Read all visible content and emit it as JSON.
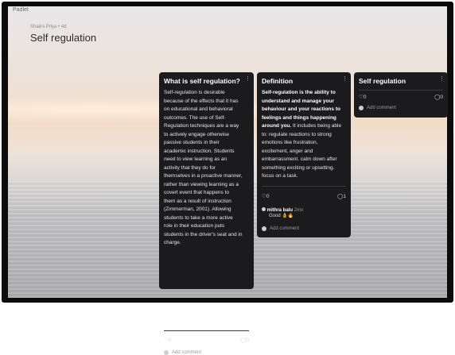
{
  "app": {
    "logo": "Padlet"
  },
  "board": {
    "meta": "Shalini Priya • 4d",
    "title": "Self regulation"
  },
  "cards": [
    {
      "title": "What is self regulation?",
      "body_lines": [
        "Self-regulation is desirable",
        "because of the effects that it has",
        "on educational and behavioral",
        "outcomes. The use of Self-",
        "Regulation techniques are a way",
        "to actively engage otherwise",
        "passive students in their",
        "academic instruction. Students",
        "need to view learning as an",
        "activity that they do for",
        "themselves in a proactive manner,",
        "rather than viewing learning as a",
        "covert event that happens to",
        "them as a result of instruction",
        "(Zimmerman, 2001). Allowing",
        "students to take a more active",
        "role in their education puts",
        "students in the driver's seat and in",
        "charge."
      ],
      "likes": "0",
      "comments": "0",
      "add_comment": "Add comment"
    },
    {
      "title": "Definition",
      "body_lines": [
        {
          "bold": true,
          "text": "Self-regulation is the ability to"
        },
        {
          "bold": true,
          "text": "understand and manage your"
        },
        {
          "bold": true,
          "text": "behaviour and your reactions to"
        },
        {
          "bold": true,
          "text": "feelings and things happening"
        },
        {
          "bold": true,
          "text": "around you.",
          "rest": " It includes being able"
        },
        {
          "bold": false,
          "text": "to: regulate reactions to strong"
        },
        {
          "bold": false,
          "text": "emotions like frustration,"
        },
        {
          "bold": false,
          "text": "excitement, anger and"
        },
        {
          "bold": false,
          "text": "embarrassment. calm down after"
        },
        {
          "bold": false,
          "text": "something exciting or upsetting."
        },
        {
          "bold": false,
          "text": "focus on a task."
        }
      ],
      "likes": "0",
      "comments": "1",
      "comment_item": {
        "author": "mithra balu",
        "time": "2mo",
        "text": "Good 👌🔥"
      },
      "add_comment": "Add comment"
    },
    {
      "title": "Self regulation",
      "likes": "0",
      "comments": "0",
      "add_comment": "Add comment"
    }
  ],
  "icons": {
    "like": "heart-outline-icon",
    "comment": "speech-bubble-icon",
    "more": "kebab-menu-icon",
    "avatar": "user-avatar-icon"
  }
}
